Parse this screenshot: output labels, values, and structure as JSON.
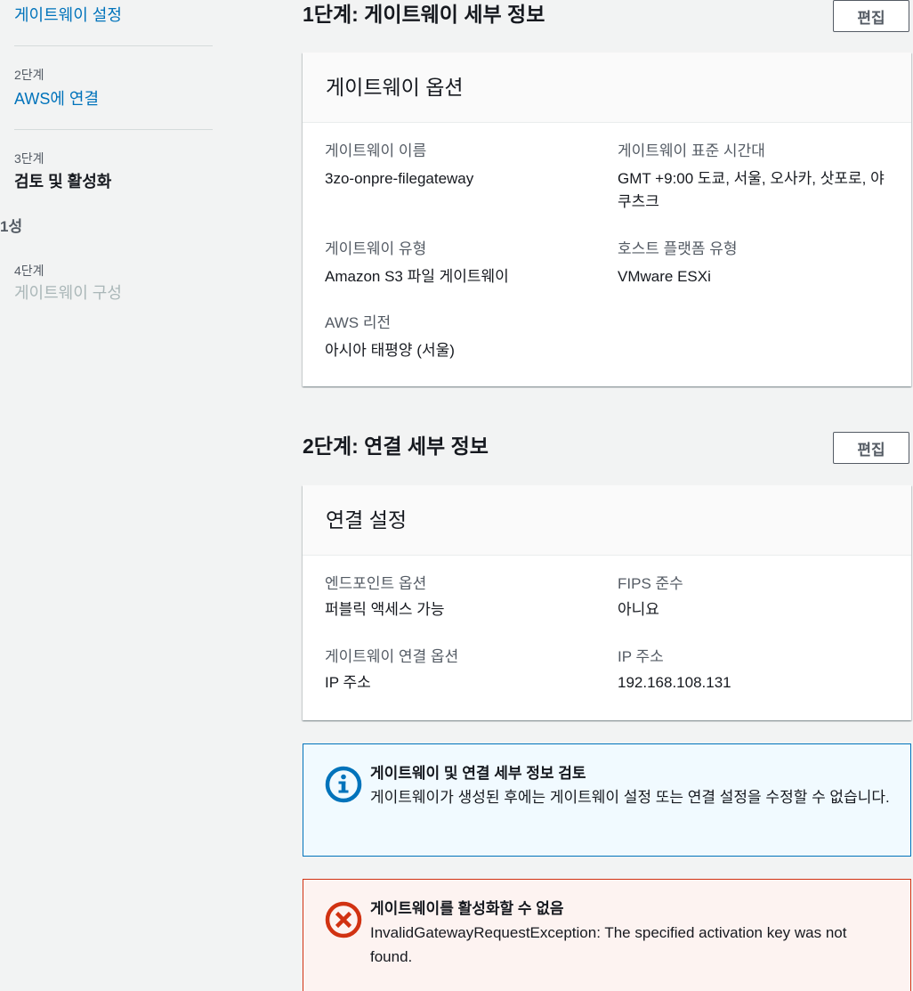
{
  "nav": {
    "step1_link": "게이트웨이 설정",
    "step2_label": "2단계",
    "step2_link": "AWS에 연결",
    "step3_label": "3단계",
    "step3_title": "검토 및 활성화",
    "fragment": "1성",
    "step4_label": "4단계",
    "step4_title": "게이트웨이 구성"
  },
  "section1": {
    "title": "1단계: 게이트웨이 세부 정보",
    "edit_label": "편집",
    "card_title": "게이트웨이 옵션",
    "fields": [
      {
        "label": "게이트웨이 이름",
        "value": "3zo-onpre-filegateway"
      },
      {
        "label": "게이트웨이 표준 시간대",
        "value": "GMT +9:00 도쿄, 서울, 오사카, 삿포로, 야쿠츠크"
      },
      {
        "label": "게이트웨이 유형",
        "value": "Amazon S3 파일 게이트웨이"
      },
      {
        "label": "호스트 플랫폼 유형",
        "value": "VMware ESXi"
      },
      {
        "label": "AWS 리전",
        "value": "아시아 태평양 (서울)"
      }
    ]
  },
  "section2": {
    "title": "2단계: 연결 세부 정보",
    "edit_label": "편집",
    "card_title": "연결 설정",
    "fields": [
      {
        "label": "엔드포인트 옵션",
        "value": "퍼블릭 액세스 가능"
      },
      {
        "label": "FIPS 준수",
        "value": "아니요"
      },
      {
        "label": "게이트웨이 연결 옵션",
        "value": "IP 주소"
      },
      {
        "label": "IP 주소",
        "value": "192.168.108.131"
      }
    ]
  },
  "info_alert": {
    "icon": "info-icon",
    "title": "게이트웨이 및 연결 세부 정보 검토",
    "text": "게이트웨이가 생성된 후에는 게이트웨이 설정 또는 연결 설정을 수정할 수 없습니다."
  },
  "error_alert": {
    "icon": "error-icon",
    "title": "게이트웨이를 활성화할 수 없음",
    "text": "InvalidGatewayRequestException: The specified activation key was not found."
  },
  "colors": {
    "link": "#0073bb",
    "info": "#0073bb",
    "error": "#d13212",
    "background": "#f2f3f3"
  }
}
